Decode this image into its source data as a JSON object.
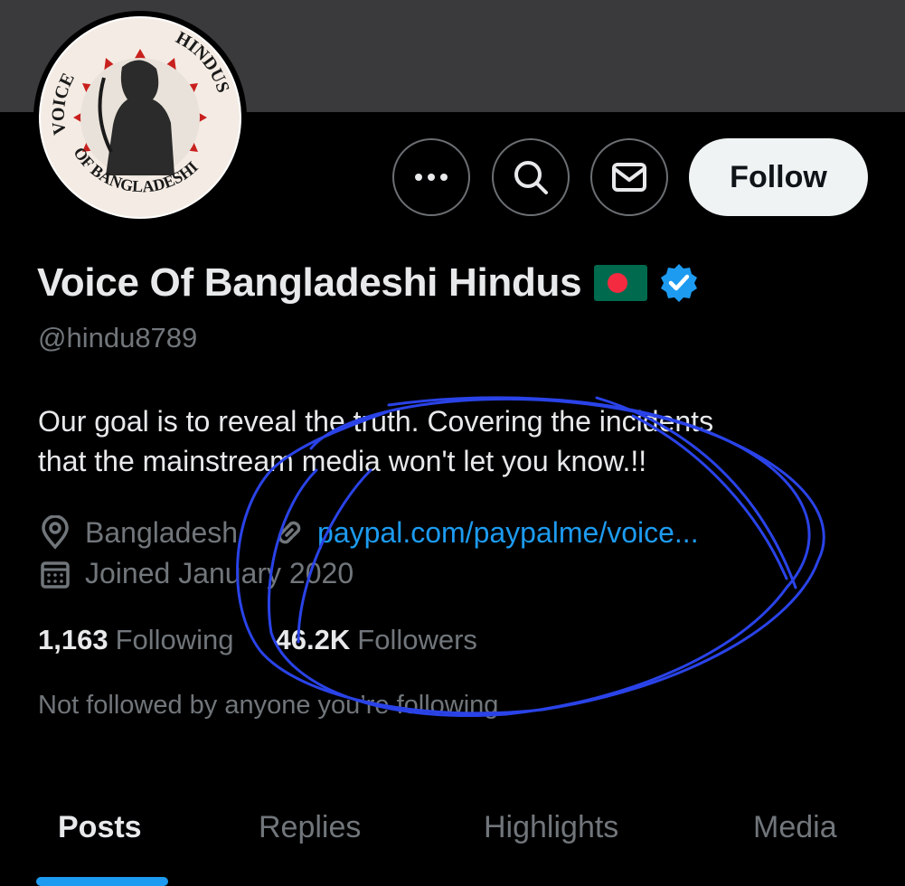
{
  "header": {
    "follow_label": "Follow",
    "more_icon": "more-horizontal-icon",
    "search_icon": "search-icon",
    "message_icon": "envelope-icon"
  },
  "avatar": {
    "logo_text_left": "VOICE",
    "logo_text_bottom": "OF BANGLADESHI",
    "logo_text_right": "HINDUS"
  },
  "profile": {
    "display_name": "Voice Of Bangladeshi Hindus",
    "handle": "@hindu8789",
    "bio_line1": "Our goal is to reveal the truth. Covering the incidents",
    "bio_line2": "that the mainstream media won't let you know.!!",
    "location": "Bangladesh",
    "website": "paypal.com/paypalme/voice...",
    "joined": "Joined January 2020",
    "following_count": "1,163",
    "following_label": "Following",
    "followers_count": "46.2K",
    "followers_label": "Followers",
    "not_followed": "Not followed by anyone you’re following"
  },
  "tabs": [
    {
      "label": "Posts"
    },
    {
      "label": "Replies"
    },
    {
      "label": "Highlights"
    },
    {
      "label": "Media"
    }
  ],
  "colors": {
    "background": "#000000",
    "banner": "#3a3a3c",
    "accent": "#1d9bf0",
    "text_primary": "#e7e9ea",
    "text_secondary": "#71767b",
    "scribble": "#2a43e8"
  }
}
